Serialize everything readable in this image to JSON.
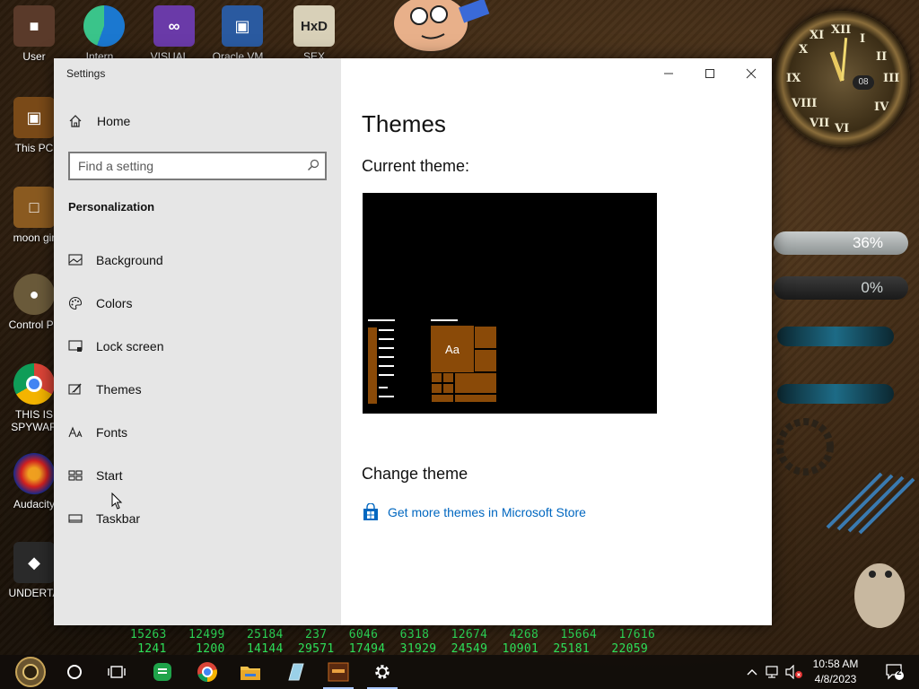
{
  "desktop": {
    "icons": [
      {
        "label": "User",
        "icon": "user-folder-icon",
        "color": "#5a3a2a"
      },
      {
        "label": "This PC",
        "icon": "this-pc-icon",
        "color": "#7a4a18"
      },
      {
        "label": "moon gir",
        "icon": "folder-icon",
        "color": "#8a5a20"
      },
      {
        "label": "Control Pa",
        "icon": "control-panel-icon",
        "color": "#6a5a3a"
      },
      {
        "label": "THIS IS",
        "label2": "SPYWAR",
        "icon": "chrome-icon",
        "color": "#dd4433"
      },
      {
        "label": "Audacity",
        "icon": "audacity-icon",
        "color": "#1a2a8a"
      },
      {
        "label": "UNDERTA",
        "icon": "unity-icon",
        "color": "#2a2a2a"
      },
      {
        "label": "Intern...",
        "icon": "edge-icon",
        "color": "#1b78d0"
      },
      {
        "label": "VISUAL...",
        "icon": "visual-studio-icon",
        "color": "#6a3aa8"
      },
      {
        "label": "Oracle VM...",
        "icon": "virtualbox-icon",
        "color": "#2a5aa0"
      },
      {
        "label": "SEX",
        "icon": "hxd-icon",
        "color": "#d8d0b8"
      }
    ],
    "meters": [
      {
        "label": "36%",
        "value": 36
      },
      {
        "label": "0%",
        "value": 0
      }
    ],
    "number_rows": [
      "15263   12499   25184   237   6046   6318   12674   4268   15664   17616",
      " 1241    1200   14144  29571  17494  31929  24549  10901  25181   22059"
    ]
  },
  "window": {
    "title": "Settings",
    "controls": {
      "minimize": "minimize",
      "maximize": "maximize",
      "close": "close"
    }
  },
  "sidebar": {
    "home_label": "Home",
    "search_placeholder": "Find a setting",
    "section_title": "Personalization",
    "items": [
      {
        "label": "Background",
        "icon": "image-icon"
      },
      {
        "label": "Colors",
        "icon": "palette-icon"
      },
      {
        "label": "Lock screen",
        "icon": "lock-screen-icon"
      },
      {
        "label": "Themes",
        "icon": "brush-icon"
      },
      {
        "label": "Fonts",
        "icon": "font-icon"
      },
      {
        "label": "Start",
        "icon": "start-grid-icon"
      },
      {
        "label": "Taskbar",
        "icon": "taskbar-icon"
      }
    ]
  },
  "main": {
    "page_title": "Themes",
    "current_theme_label": "Current theme:",
    "preview_text": "Aa",
    "change_theme_label": "Change theme",
    "store_link_label": "Get more themes in Microsoft Store",
    "accent_color": "#8a4a08",
    "link_color": "#0067c0"
  },
  "taskbar": {
    "time": "10:58 AM",
    "date": "4/8/2023",
    "notification_count": "2",
    "apps": [
      "start-button",
      "cortana-icon",
      "task-view-icon",
      "sheets-icon",
      "chrome-icon",
      "file-explorer-icon",
      "notepad-icon",
      "game-icon",
      "settings-icon"
    ]
  }
}
